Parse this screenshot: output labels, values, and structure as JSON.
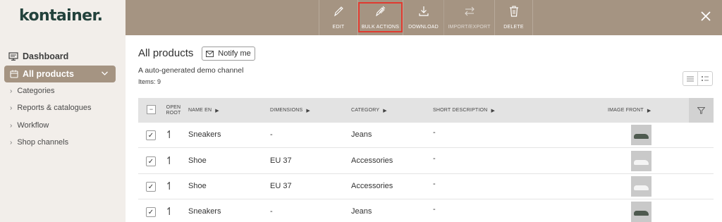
{
  "brand": {
    "logo_text": "kontainer."
  },
  "sidebar": {
    "dashboard_label": "Dashboard",
    "active_label": "All products",
    "items": [
      {
        "label": "Categories"
      },
      {
        "label": "Reports & catalogues"
      },
      {
        "label": "Workflow"
      },
      {
        "label": "Shop channels"
      }
    ]
  },
  "toolbar": {
    "tools": [
      {
        "label": "EDIT",
        "icon": "pencil-icon"
      },
      {
        "label": "BULK ACTIONS",
        "icon": "multi-pencil-icon",
        "highlighted": true
      },
      {
        "label": "DOWNLOAD",
        "icon": "download-icon"
      },
      {
        "label": "IMPORT/EXPORT",
        "icon": "swap-icon"
      },
      {
        "label": "DELETE",
        "icon": "trash-icon"
      }
    ],
    "close_icon": "close-icon"
  },
  "main": {
    "title": "All products",
    "notify_label": "Notify me",
    "subtitle": "A auto-generated demo channel",
    "items_count": "Items: 9"
  },
  "table": {
    "columns": {
      "open_root": "OPEN ROOT",
      "name": "NAME EN",
      "dimensions": "DIMENSIONS",
      "category": "CATEGORY",
      "short_description": "SHORT DESCRIPTION",
      "image_front": "IMAGE FRONT"
    },
    "rows": [
      {
        "name": "Sneakers",
        "dimensions": "-",
        "category": "Jeans",
        "short_description": "-",
        "checked": true,
        "shoe": "dark"
      },
      {
        "name": "Shoe",
        "dimensions": "EU 37",
        "category": "Accessories",
        "short_description": "-",
        "checked": true,
        "shoe": "white"
      },
      {
        "name": "Shoe",
        "dimensions": "EU 37",
        "category": "Accessories",
        "short_description": "-",
        "checked": true,
        "shoe": "white"
      },
      {
        "name": "Sneakers",
        "dimensions": "-",
        "category": "Jeans",
        "short_description": "-",
        "checked": true,
        "shoe": "dark"
      }
    ]
  },
  "colors": {
    "brand_dark": "#23423c",
    "toolbar_bg": "#a59482",
    "highlight": "#e03a2f",
    "sidebar_bg": "#f2eeea"
  }
}
